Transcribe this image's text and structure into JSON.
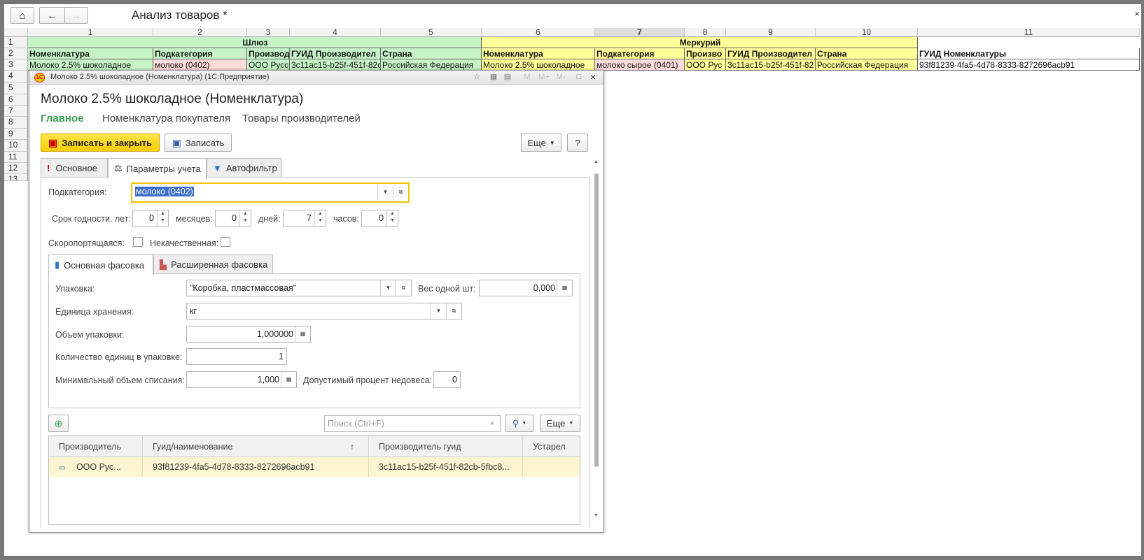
{
  "app": {
    "doc_title": "Анализ товаров *",
    "close": "×"
  },
  "sheet": {
    "columns": [
      "1",
      "2",
      "3",
      "4",
      "5",
      "6",
      "7",
      "8",
      "9",
      "10",
      "11"
    ],
    "rows": [
      "1",
      "2",
      "3",
      "4",
      "5",
      "6",
      "7",
      "8",
      "9",
      "10",
      "11",
      "12",
      "13"
    ],
    "group_headers": {
      "gateway": "Шлюз",
      "mercury": "Меркурий"
    },
    "headers": [
      "Номенклатура",
      "Подкатегория",
      "Производ",
      "ГУИД Производител",
      "Страна",
      "Номенклатура",
      "Подкатегория",
      "Произво",
      "ГУИД Производител",
      "Страна",
      "ГУИД Номенклатуры"
    ],
    "row3": [
      "Молоко 2.5% шоколадное",
      "молоко (0402)",
      "ООО Русс",
      "3c11ac15-b25f-451f-82c",
      "Российская Федерация",
      "Молоко 2.5% шоколадное",
      "молоко сырое (0401)",
      "ООО Рус",
      "3c11ac15-b25f-451f-82",
      "Российская Федерация",
      "93f81239-4fa5-4d78-8333-8272696acb91"
    ]
  },
  "dialog": {
    "window_title": "Молоко 2.5% шоколадное (Номенклатура)  (1С:Предприятие)",
    "form_title": "Молоко 2.5% шоколадное (Номенклатура)",
    "nav_tabs": [
      "Главное",
      "Номенклатура покупателя",
      "Товары производителей"
    ],
    "buttons": {
      "save_close": "Записать и закрыть",
      "save": "Записать",
      "more": "Еще",
      "help": "?"
    },
    "tabs": [
      "Основное",
      "Параметры учета",
      "Автофильтр"
    ],
    "subcategory": {
      "label": "Подкатегория:",
      "value": "молоко (0402)"
    },
    "shelf_life": {
      "label": "Срок годности. лет:",
      "years": "0",
      "months_label": "месяцев:",
      "months": "0",
      "days_label": "дней:",
      "days": "7",
      "hours_label": "часов:",
      "hours": "0"
    },
    "perishable_label": "Скоропортящаяся:",
    "substandard_label": "Некачественная:",
    "pack_tabs": [
      "Основная фасовка",
      "Расширенная фасовка"
    ],
    "pack": {
      "packaging_label": "Упаковка:",
      "packaging_value": "\"Коробка, пластмассовая\"",
      "unit_weight_label": "Вес одной шт:",
      "unit_weight_value": "0,000",
      "storage_unit_label": "Единица хранения:",
      "storage_unit_value": "кг",
      "pack_volume_label": "Объем упаковки:",
      "pack_volume_value": "1,000000",
      "units_per_pack_label": "Количество единиц в упаковке:",
      "units_per_pack_value": "1",
      "min_writeoff_label": "Минимальный объем списания:",
      "min_writeoff_value": "1,000",
      "underweight_label": "Допустимый процент недовеса:",
      "underweight_value": "0"
    },
    "search_placeholder": "Поиск (Ctrl+F)",
    "table": {
      "columns": [
        "Производитель",
        "Гуид/наименование",
        "Производитель гуид",
        "Устарел"
      ],
      "sort_indicator": "↑",
      "row": [
        "ООО Рус...",
        "93f81239-4fa5-4d78-8333-8272696acb91",
        "3c11ac15-b25f-451f-82cb-5fbc8...",
        ""
      ]
    }
  }
}
